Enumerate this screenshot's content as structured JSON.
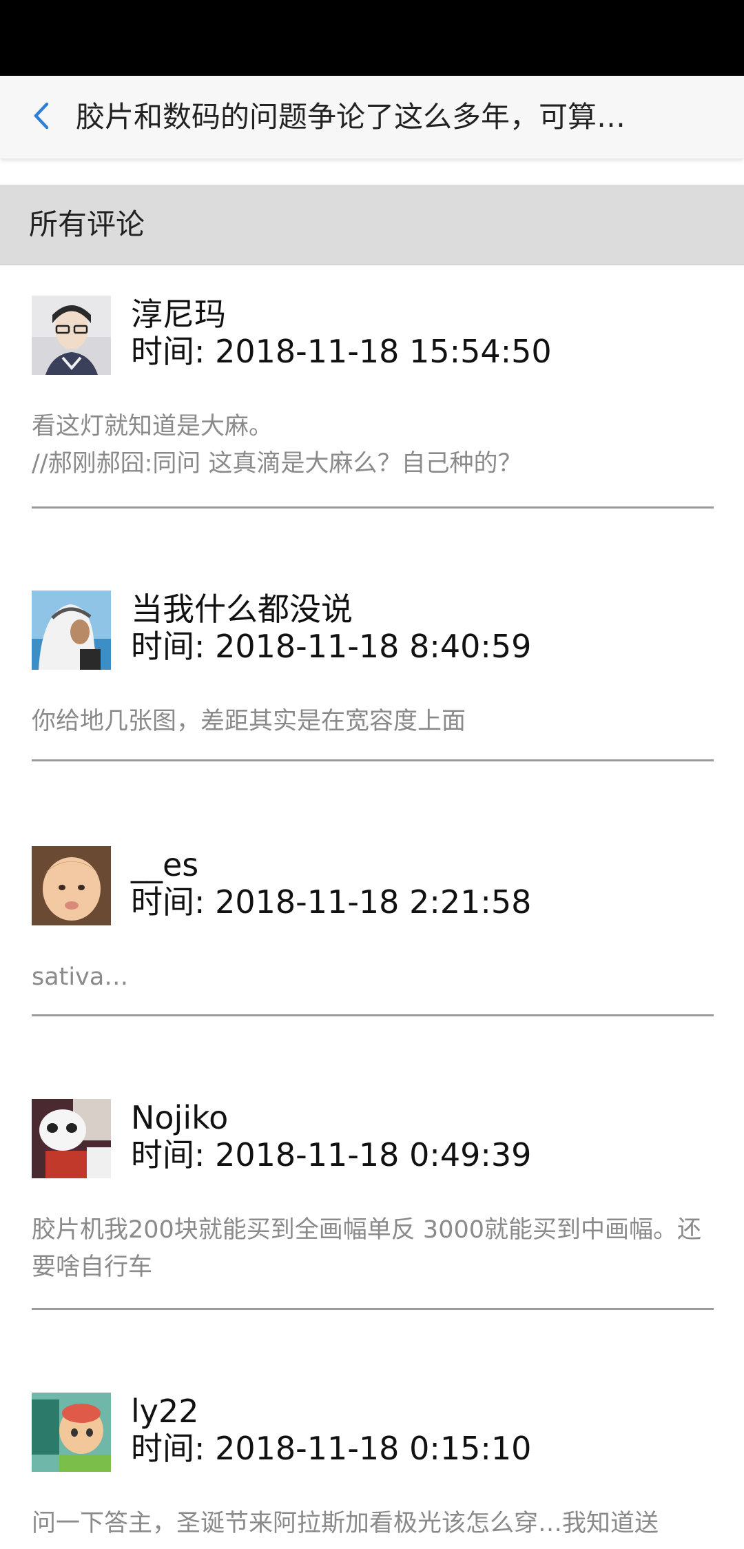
{
  "header": {
    "title": "胶片和数码的问题争论了这么多年，可算…",
    "back_icon": "chevron-left-icon",
    "accent_color": "#2f7fd8"
  },
  "section": {
    "title": "所有评论"
  },
  "comments": [
    {
      "username": "淳尼玛",
      "time_label": "时间: 2018-11-18 15:54:50",
      "text": "看这灯就知道是大麻。\n//郝刚郝囧:同问 这真滴是大麻么？自己种的？"
    },
    {
      "username": "当我什么都没说",
      "time_label": "时间: 2018-11-18 8:40:59",
      "text": "你给地几张图，差距其实是在宽容度上面"
    },
    {
      "username": "__es",
      "time_label": "时间: 2018-11-18 2:21:58",
      "text": "sativa…"
    },
    {
      "username": "Nojiko",
      "time_label": "时间: 2018-11-18 0:49:39",
      "text": "胶片机我200块就能买到全画幅单反 3000就能买到中画幅。还要啥自行车"
    },
    {
      "username": "ly22",
      "time_label": "时间: 2018-11-18 0:15:10",
      "text": "问一下答主，圣诞节来阿拉斯加看极光该怎么穿…我知道送"
    }
  ]
}
